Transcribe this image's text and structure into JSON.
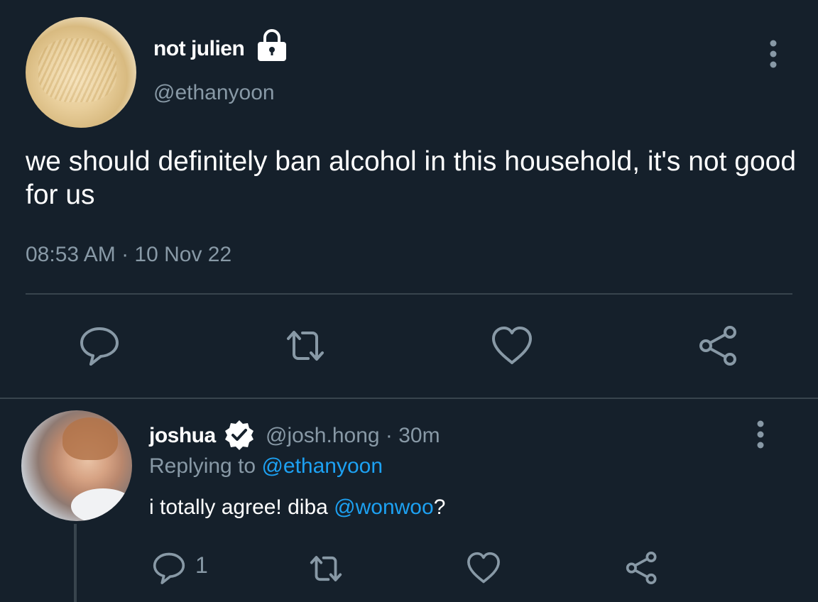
{
  "tweet": {
    "author_name": "not julien",
    "author_handle": "@ethanyoon",
    "text": "we should definitely ban alcohol in this household, it's not good for us",
    "timestamp": "08:53 AM · 10 Nov 22",
    "icons": [
      "lock-icon",
      "more-vertical-icon",
      "reply-icon",
      "retweet-icon",
      "like-icon",
      "share-icon"
    ]
  },
  "reply": {
    "author_name": "joshua",
    "author_handle": "@josh.hong · 30m",
    "replying_prefix": "Replying to ",
    "replying_handle": "@ethanyoon",
    "text_before": "i totally agree! diba ",
    "mention": "@wonwoo",
    "text_after": "?",
    "reply_count": "1",
    "icons": [
      "verified-icon",
      "more-vertical-icon",
      "reply-icon",
      "retweet-icon",
      "like-icon",
      "share-icon"
    ]
  },
  "colors": {
    "background": "#15202b",
    "text_primary": "#ffffff",
    "text_secondary": "#8899a6",
    "accent_link": "#1da1f2",
    "divider": "#38444d"
  }
}
